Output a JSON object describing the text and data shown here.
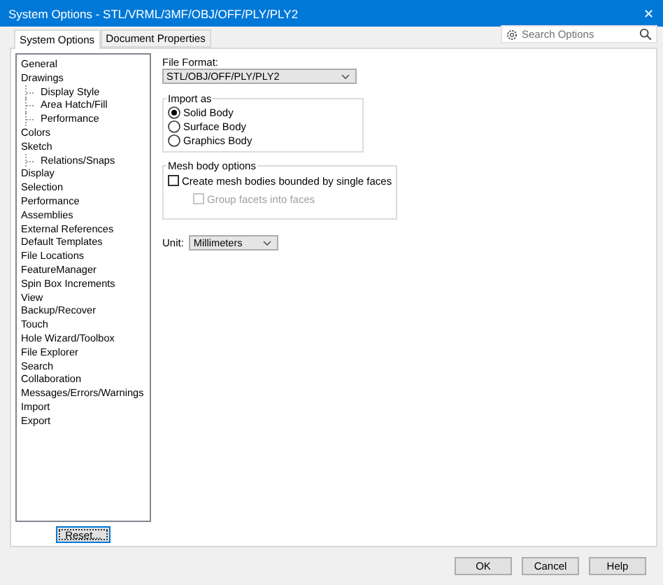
{
  "window": {
    "title": "System Options - STL/VRML/3MF/OBJ/OFF/PLY/PLY2",
    "close": "✕"
  },
  "tabs": [
    {
      "label": "System Options",
      "selected": true
    },
    {
      "label": "Document Properties",
      "selected": false
    }
  ],
  "search": {
    "placeholder": "Search Options"
  },
  "tree": [
    {
      "label": "General",
      "selected": false
    },
    {
      "label": "Drawings",
      "selected": false,
      "children": [
        {
          "label": "Display Style",
          "selected": false
        },
        {
          "label": "Area Hatch/Fill",
          "selected": false
        },
        {
          "label": "Performance",
          "selected": false
        }
      ]
    },
    {
      "label": "Colors",
      "selected": false
    },
    {
      "label": "Sketch",
      "selected": false,
      "children": [
        {
          "label": "Relations/Snaps",
          "selected": false
        }
      ]
    },
    {
      "label": "Display",
      "selected": false
    },
    {
      "label": "Selection",
      "selected": false
    },
    {
      "label": "Performance",
      "selected": false
    },
    {
      "label": "Assemblies",
      "selected": false
    },
    {
      "label": "External References",
      "selected": false
    },
    {
      "label": "Default Templates",
      "selected": false
    },
    {
      "label": "File Locations",
      "selected": false
    },
    {
      "label": "FeatureManager",
      "selected": false
    },
    {
      "label": "Spin Box Increments",
      "selected": false
    },
    {
      "label": "View",
      "selected": false
    },
    {
      "label": "Backup/Recover",
      "selected": false
    },
    {
      "label": "Touch",
      "selected": false
    },
    {
      "label": "Hole Wizard/Toolbox",
      "selected": false
    },
    {
      "label": "File Explorer",
      "selected": false
    },
    {
      "label": "Search",
      "selected": false
    },
    {
      "label": "Collaboration",
      "selected": false
    },
    {
      "label": "Messages/Errors/Warnings",
      "selected": false
    },
    {
      "label": "Import",
      "selected": false
    },
    {
      "label": "Export",
      "selected": false
    }
  ],
  "reset_button": "Reset...",
  "file_format": {
    "label": "File Format:",
    "value": "STL/OBJ/OFF/PLY/PLY2"
  },
  "import_as": {
    "title": "Import as",
    "options": [
      {
        "label": "Solid Body",
        "selected": true
      },
      {
        "label": "Surface Body",
        "selected": false
      },
      {
        "label": "Graphics Body",
        "selected": false
      }
    ]
  },
  "mesh_options": {
    "title": "Mesh body options",
    "checkboxes": [
      {
        "label": "Create mesh bodies bounded by single faces",
        "checked": false,
        "disabled": false
      },
      {
        "label": "Group facets into faces",
        "checked": false,
        "disabled": true
      }
    ]
  },
  "unit": {
    "label": "Unit:",
    "value": "Millimeters"
  },
  "buttons": [
    "OK",
    "Cancel",
    "Help"
  ]
}
